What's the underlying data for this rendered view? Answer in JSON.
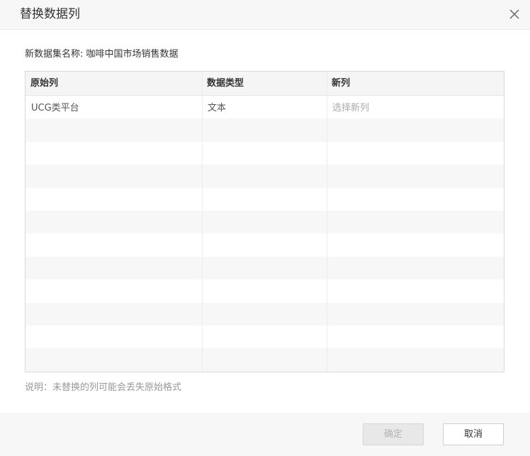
{
  "dialog": {
    "title": "替换数据列",
    "close_icon": "close-icon"
  },
  "dataset": {
    "label": "新数据集名称:",
    "name": "咖啡中国市场销售数据"
  },
  "table": {
    "headers": [
      "原始列",
      "数据类型",
      "新列"
    ],
    "rows": [
      {
        "original": "UCG类平台",
        "type": "文本",
        "new_placeholder": "选择新列"
      }
    ]
  },
  "note": "说明：未替换的列可能会丢失原始格式",
  "footer": {
    "confirm_label": "确定",
    "cancel_label": "取消"
  }
}
